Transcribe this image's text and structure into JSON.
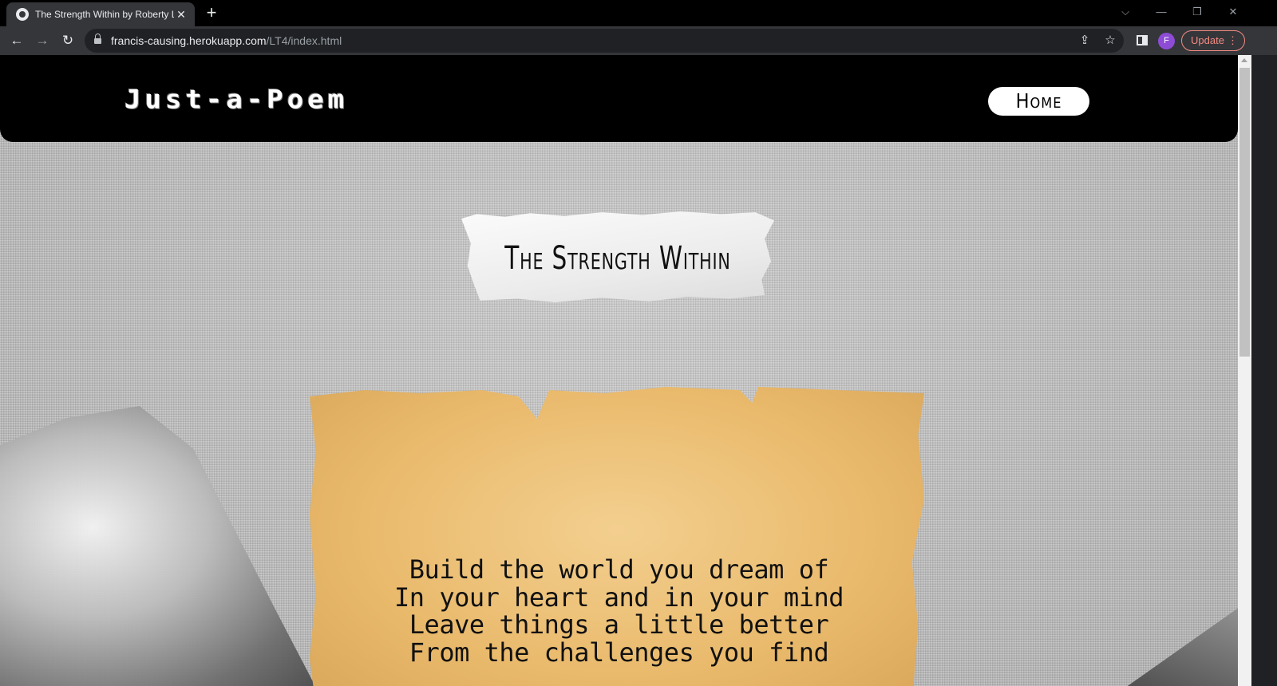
{
  "browser": {
    "tab_title": "The Strength Within by Roberty L",
    "close_glyph": "✕",
    "new_tab_glyph": "+",
    "url_host": "francis-causing.herokuapp.com",
    "url_path": "/LT4/index.html",
    "profile_initial": "F",
    "update_label": "Update",
    "icons": [
      "globe-icon",
      "close-icon",
      "plus-icon",
      "chevron-down-icon",
      "minimize-icon",
      "restore-icon",
      "window-close-icon",
      "back-icon",
      "forward-icon",
      "reload-icon",
      "lock-icon",
      "share-icon",
      "star-icon",
      "side-panel-icon",
      "more-icon"
    ]
  },
  "site": {
    "logo": "Just-a-Poem",
    "nav": {
      "home_label": "Home"
    }
  },
  "poem": {
    "title": "The Strength Within",
    "lines": [
      "Build the world you dream of",
      "In your heart and in your mind",
      "Leave things a little better",
      "From the challenges you find"
    ]
  },
  "colors": {
    "header_bg": "#000000",
    "title_paper": "#f2f2f2",
    "parchment": "#ecbd72",
    "update_accent": "#f28b82",
    "avatar": "#8e4cd6"
  }
}
